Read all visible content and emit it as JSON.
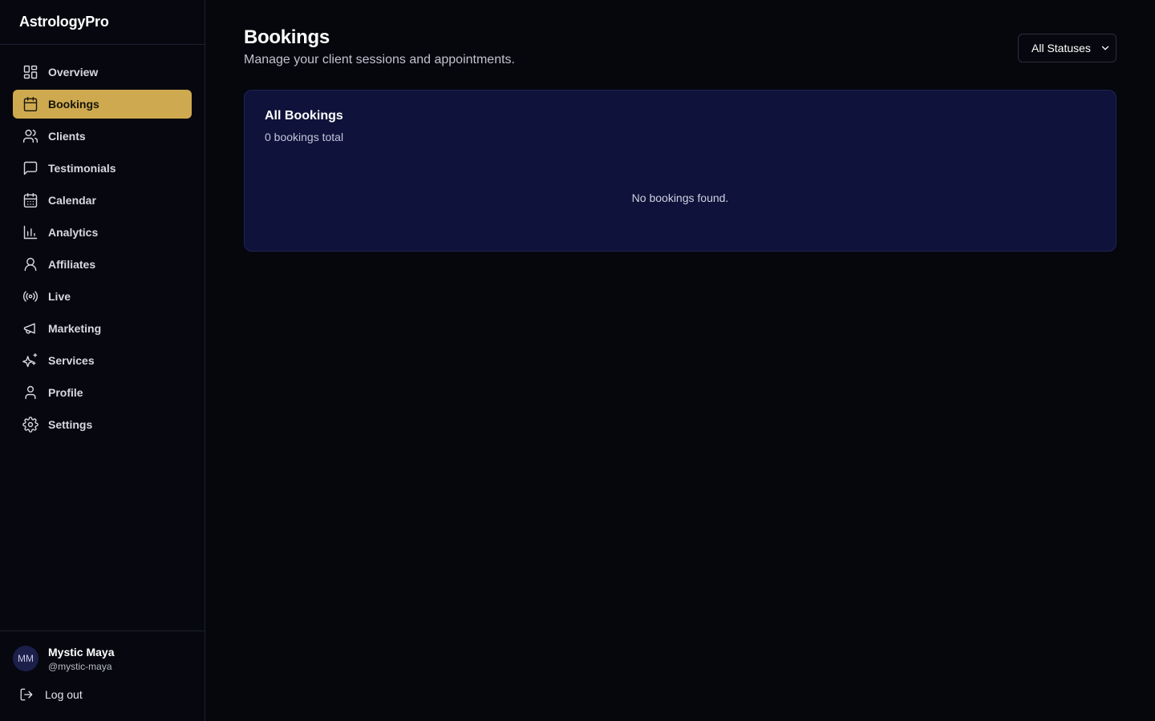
{
  "app": {
    "title": "AstrologyPro"
  },
  "sidebar": {
    "items": [
      {
        "label": "Overview",
        "icon": "grid-icon",
        "active": false
      },
      {
        "label": "Bookings",
        "icon": "calendar-icon",
        "active": true
      },
      {
        "label": "Clients",
        "icon": "users-icon",
        "active": false
      },
      {
        "label": "Testimonials",
        "icon": "message-square-icon",
        "active": false
      },
      {
        "label": "Calendar",
        "icon": "calendar-days-icon",
        "active": false
      },
      {
        "label": "Analytics",
        "icon": "bar-chart-icon",
        "active": false
      },
      {
        "label": "Affiliates",
        "icon": "user-circle-icon",
        "active": false
      },
      {
        "label": "Live",
        "icon": "radio-icon",
        "active": false
      },
      {
        "label": "Marketing",
        "icon": "megaphone-icon",
        "active": false
      },
      {
        "label": "Services",
        "icon": "sparkles-icon",
        "active": false
      },
      {
        "label": "Profile",
        "icon": "user-icon",
        "active": false
      },
      {
        "label": "Settings",
        "icon": "gear-icon",
        "active": false
      }
    ]
  },
  "user": {
    "initials": "MM",
    "name": "Mystic Maya",
    "handle": "@mystic-maya",
    "logout_label": "Log out"
  },
  "header": {
    "title": "Bookings",
    "subtitle": "Manage your client sessions and appointments.",
    "status_filter": "All Statuses"
  },
  "card": {
    "title": "All Bookings",
    "count_text": "0 bookings total",
    "empty_text": "No bookings found."
  },
  "colors": {
    "accent": "#cea94f",
    "card_bg": "#0f123a",
    "page_bg": "#06070d"
  }
}
